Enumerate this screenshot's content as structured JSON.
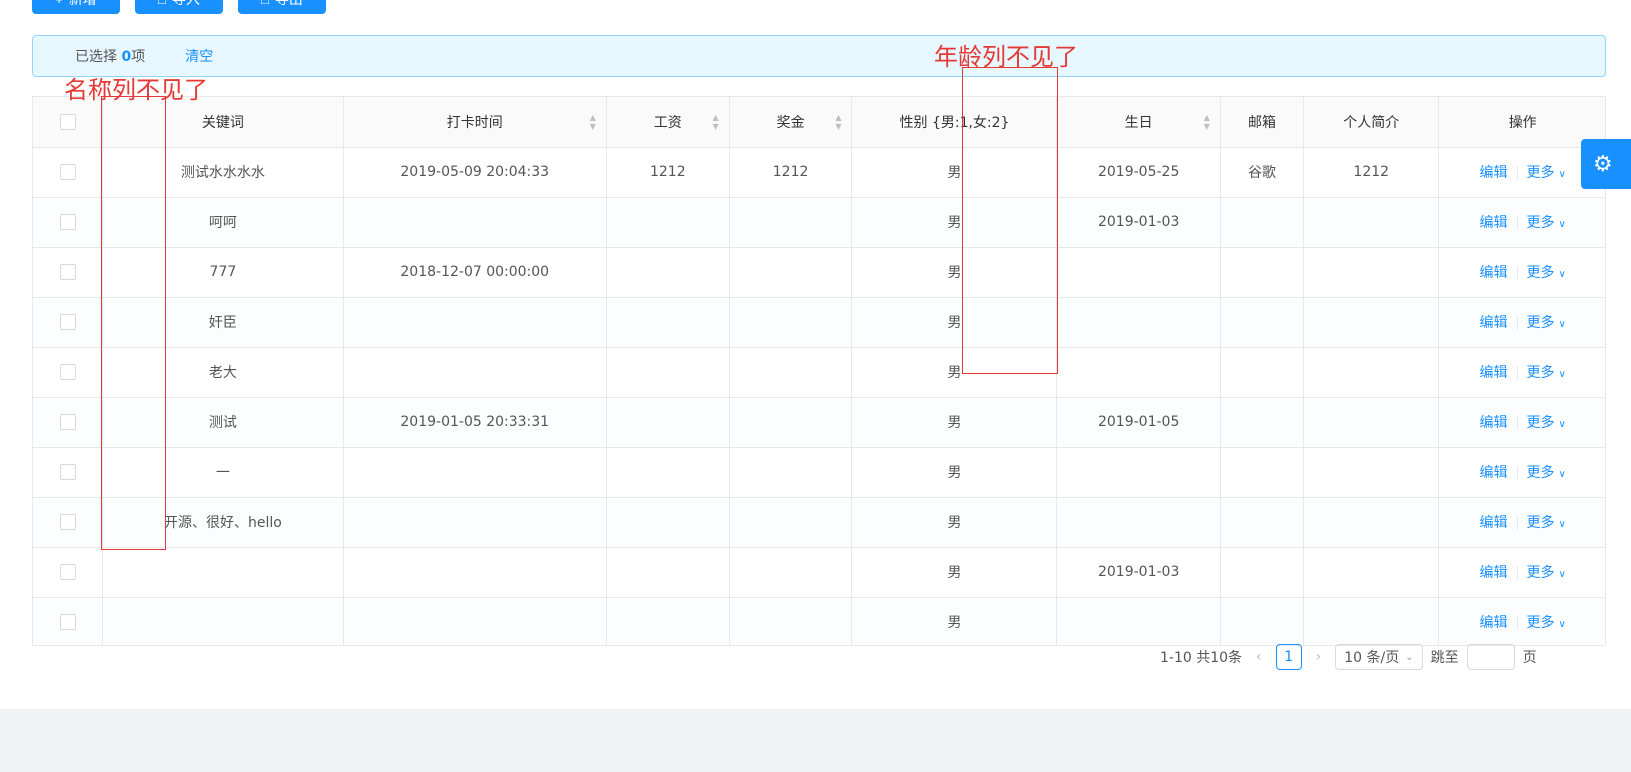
{
  "toolbar": {
    "add_label": "新增",
    "import_label": "导入",
    "export_label": "导出"
  },
  "selection": {
    "prefix": "已选择",
    "count": "0",
    "suffix": "项",
    "clear_label": "清空"
  },
  "table": {
    "headers": {
      "keyword": "关键词",
      "punch_time": "打卡时间",
      "salary": "工资",
      "bonus": "奖金",
      "gender": "性别 {男:1,女:2}",
      "birthday": "生日",
      "email": "邮箱",
      "profile": "个人简介",
      "actions": "操作"
    },
    "rows": [
      {
        "keyword": "测试水水水水",
        "punch_time": "2019-05-09 20:04:33",
        "salary": "1212",
        "bonus": "1212",
        "gender": "男",
        "birthday": "2019-05-25",
        "email": "谷歌",
        "profile": "1212"
      },
      {
        "keyword": "呵呵",
        "punch_time": "",
        "salary": "",
        "bonus": "",
        "gender": "男",
        "birthday": "2019-01-03",
        "email": "",
        "profile": ""
      },
      {
        "keyword": "777",
        "punch_time": "2018-12-07 00:00:00",
        "salary": "",
        "bonus": "",
        "gender": "男",
        "birthday": "",
        "email": "",
        "profile": ""
      },
      {
        "keyword": "奸臣",
        "punch_time": "",
        "salary": "",
        "bonus": "",
        "gender": "男",
        "birthday": "",
        "email": "",
        "profile": ""
      },
      {
        "keyword": "老大",
        "punch_time": "",
        "salary": "",
        "bonus": "",
        "gender": "男",
        "birthday": "",
        "email": "",
        "profile": ""
      },
      {
        "keyword": "测试",
        "punch_time": "2019-01-05 20:33:31",
        "salary": "",
        "bonus": "",
        "gender": "男",
        "birthday": "2019-01-05",
        "email": "",
        "profile": ""
      },
      {
        "keyword": "一",
        "punch_time": "",
        "salary": "",
        "bonus": "",
        "gender": "男",
        "birthday": "",
        "email": "",
        "profile": ""
      },
      {
        "keyword": "开源、很好、hello",
        "punch_time": "",
        "salary": "",
        "bonus": "",
        "gender": "男",
        "birthday": "",
        "email": "",
        "profile": ""
      },
      {
        "keyword": "",
        "punch_time": "",
        "salary": "",
        "bonus": "",
        "gender": "男",
        "birthday": "2019-01-03",
        "email": "",
        "profile": ""
      },
      {
        "keyword": "",
        "punch_time": "",
        "salary": "",
        "bonus": "",
        "gender": "男",
        "birthday": "",
        "email": "",
        "profile": ""
      }
    ],
    "row_actions": {
      "edit_label": "编辑",
      "more_label": "更多"
    }
  },
  "pagination": {
    "total_text": "1-10 共10条",
    "current_page": "1",
    "page_size": "10 条/页",
    "jump_prefix": "跳至",
    "jump_suffix": "页"
  },
  "annotations": {
    "name_column_missing": "名称列不见了",
    "age_column_missing": "年龄列不见了"
  },
  "colors": {
    "primary": "#1890ff",
    "annotation_red": "#e53935",
    "alert_bg": "#e6f7ff"
  }
}
